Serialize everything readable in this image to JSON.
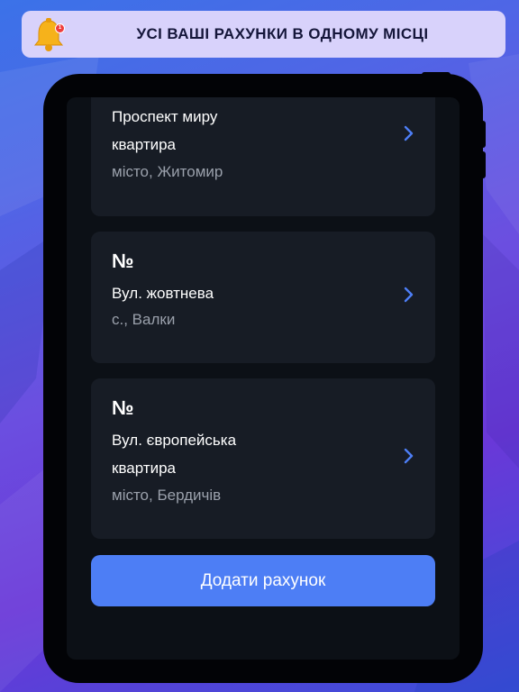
{
  "banner": {
    "title": "УСІ ВАШІ РАХУНКИ В ОДНОМУ МІСЦІ",
    "bell_icon": "bell-icon",
    "bell_badge": "1"
  },
  "accounts": [
    {
      "number": "",
      "street": "Проспект миру",
      "unit": "квартира",
      "city": "місто, Житомир",
      "chevron_icon": "chevron-right-icon"
    },
    {
      "number": "№",
      "street": "Вул. жовтнева",
      "unit": "",
      "city": "с., Валки",
      "chevron_icon": "chevron-right-icon"
    },
    {
      "number": "№",
      "street": "Вул. європейська",
      "unit": "квартира",
      "city": "місто, Бердичів",
      "chevron_icon": "chevron-right-icon"
    }
  ],
  "add_button": {
    "label": "Додати рахунок"
  },
  "colors": {
    "accent": "#4d7ef5",
    "card": "#171c25",
    "screen": "#0c1016",
    "banner": "#d8d2fb"
  }
}
